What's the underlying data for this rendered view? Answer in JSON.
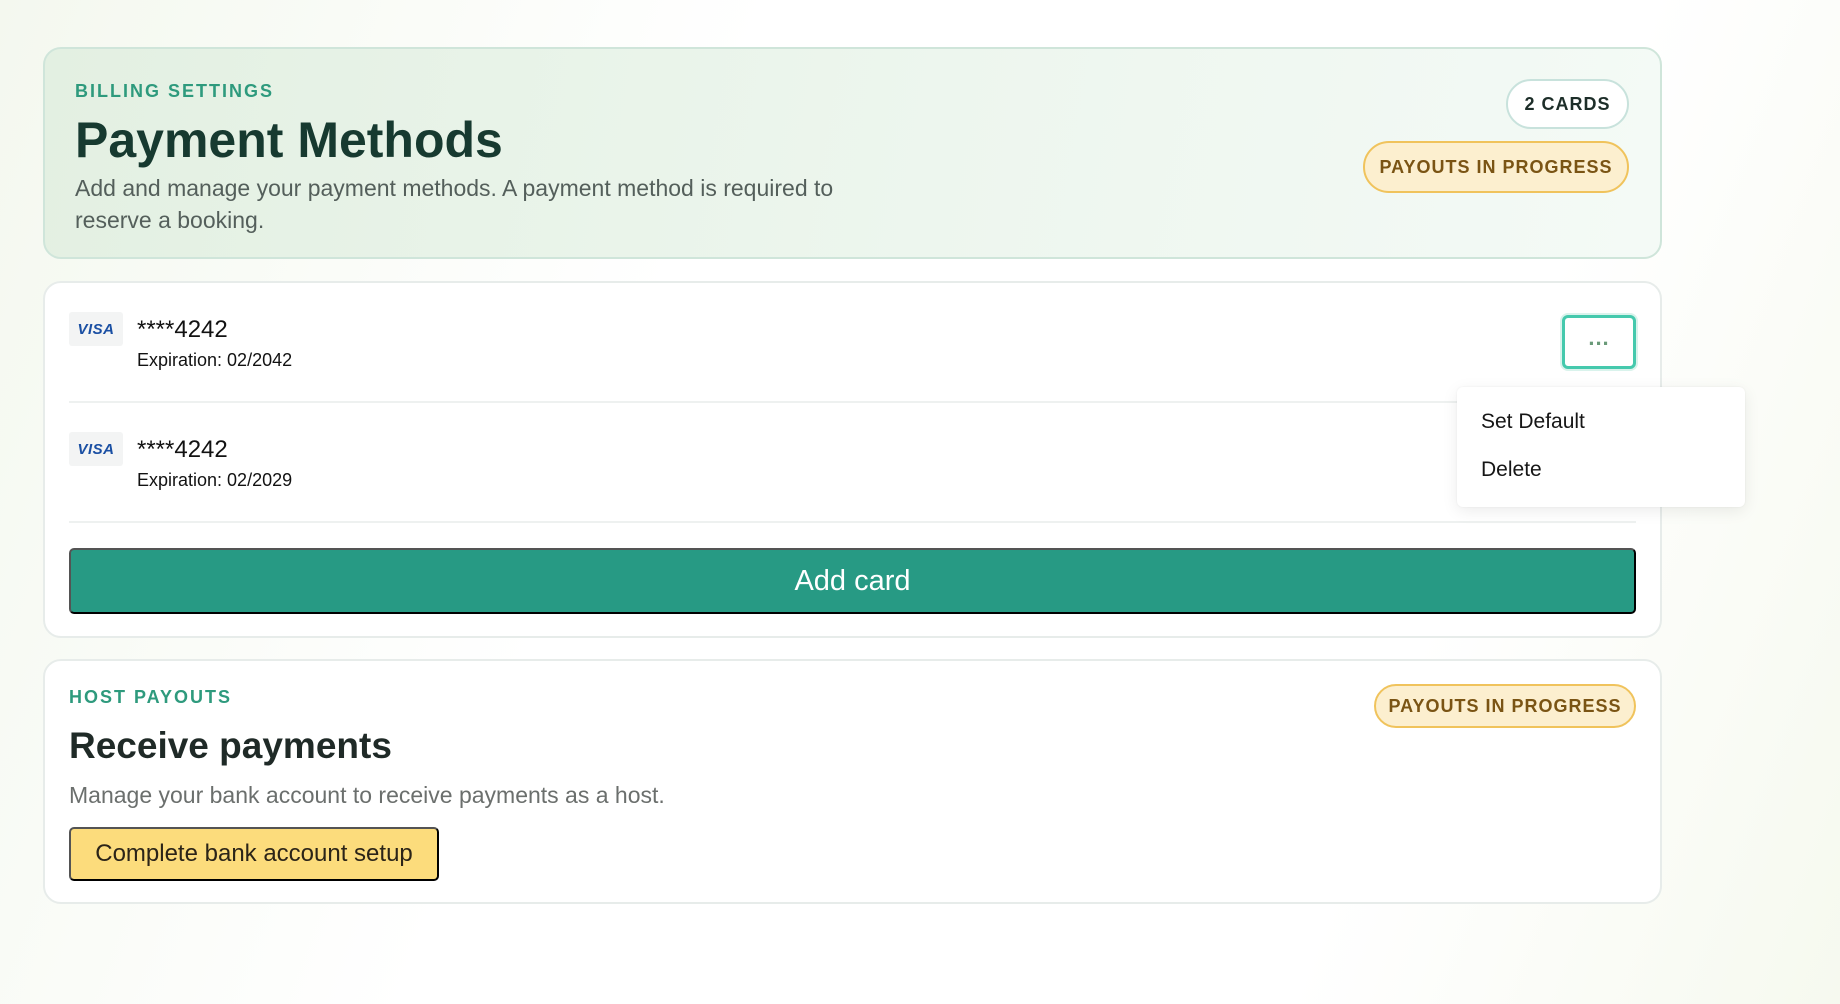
{
  "header": {
    "eyebrow": "BILLING SETTINGS",
    "title": "Payment Methods",
    "description": "Add and manage your payment methods. A payment method is required to reserve a booking.",
    "cards_count_badge": "2 CARDS",
    "status_badge": "PAYOUTS IN PROGRESS"
  },
  "cards": {
    "items": [
      {
        "brand": "VISA",
        "number": "****4242",
        "expiration": "Expiration: 02/2042"
      },
      {
        "brand": "VISA",
        "number": "****4242",
        "expiration": "Expiration: 02/2029"
      }
    ],
    "add_label": "Add card",
    "more_label": "..."
  },
  "menu": {
    "items": [
      "Set Default",
      "Delete"
    ]
  },
  "payouts": {
    "eyebrow": "HOST PAYOUTS",
    "title": "Receive payments",
    "description": "Manage your bank account to receive payments as a host.",
    "status_badge": "PAYOUTS IN PROGRESS",
    "setup_label": "Complete bank account setup"
  },
  "colors": {
    "accent": "#279a84",
    "warning_bg": "#fcefcf",
    "warning_border": "#f0c35c",
    "setup_button": "#fcdc7c"
  }
}
